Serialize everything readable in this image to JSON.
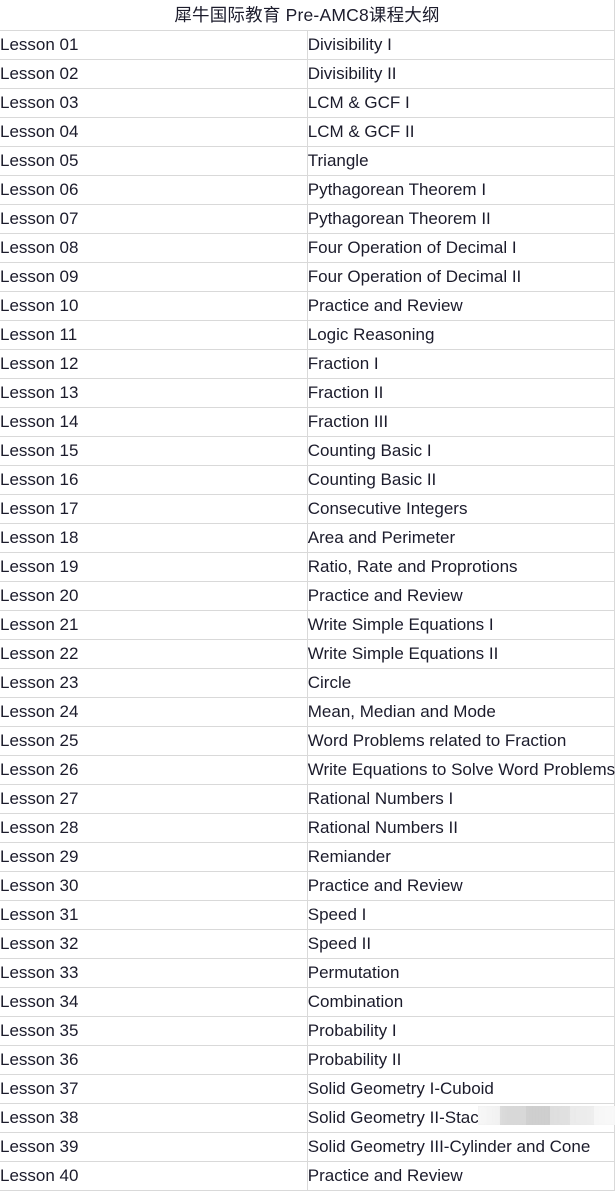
{
  "document": {
    "title": "犀牛国际教育 Pre-AMC8课程大纲"
  },
  "table": {
    "rows": [
      {
        "lesson": "Lesson 01",
        "topic": "Divisibility I"
      },
      {
        "lesson": "Lesson 02",
        "topic": "Divisibility II"
      },
      {
        "lesson": "Lesson 03",
        "topic": "LCM & GCF I"
      },
      {
        "lesson": "Lesson 04",
        "topic": "LCM & GCF II"
      },
      {
        "lesson": "Lesson 05",
        "topic": "Triangle"
      },
      {
        "lesson": "Lesson 06",
        "topic": "Pythagorean Theorem I"
      },
      {
        "lesson": "Lesson 07",
        "topic": "Pythagorean Theorem II"
      },
      {
        "lesson": "Lesson 08",
        "topic": "Four Operation of Decimal I"
      },
      {
        "lesson": "Lesson 09",
        "topic": "Four Operation of Decimal II"
      },
      {
        "lesson": "Lesson 10",
        "topic": "Practice and Review"
      },
      {
        "lesson": "Lesson 11",
        "topic": "Logic Reasoning"
      },
      {
        "lesson": "Lesson 12",
        "topic": "Fraction I"
      },
      {
        "lesson": "Lesson 13",
        "topic": "Fraction II"
      },
      {
        "lesson": "Lesson 14",
        "topic": "Fraction III"
      },
      {
        "lesson": "Lesson 15",
        "topic": "Counting Basic I"
      },
      {
        "lesson": "Lesson 16",
        "topic": "Counting Basic II"
      },
      {
        "lesson": "Lesson 17",
        "topic": "Consecutive Integers"
      },
      {
        "lesson": "Lesson 18",
        "topic": "Area and Perimeter"
      },
      {
        "lesson": "Lesson 19",
        "topic": "Ratio, Rate and Proprotions"
      },
      {
        "lesson": "Lesson 20",
        "topic": "Practice and Review"
      },
      {
        "lesson": "Lesson 21",
        "topic": "Write Simple Equations I"
      },
      {
        "lesson": "Lesson 22",
        "topic": "Write Simple Equations II"
      },
      {
        "lesson": "Lesson 23",
        "topic": "Circle"
      },
      {
        "lesson": "Lesson 24",
        "topic": "Mean, Median and Mode"
      },
      {
        "lesson": "Lesson 25",
        "topic": "Word Problems related to Fraction"
      },
      {
        "lesson": "Lesson 26",
        "topic": "Write Equations to Solve Word Problems"
      },
      {
        "lesson": "Lesson 27",
        "topic": "Rational Numbers I"
      },
      {
        "lesson": "Lesson 28",
        "topic": "Rational Numbers II"
      },
      {
        "lesson": "Lesson 29",
        "topic": "Remiander"
      },
      {
        "lesson": "Lesson 30",
        "topic": "Practice and Review"
      },
      {
        "lesson": "Lesson 31",
        "topic": "Speed I"
      },
      {
        "lesson": "Lesson 32",
        "topic": "Speed II"
      },
      {
        "lesson": "Lesson 33",
        "topic": "Permutation"
      },
      {
        "lesson": "Lesson 34",
        "topic": "Combination"
      },
      {
        "lesson": "Lesson 35",
        "topic": "Probability I"
      },
      {
        "lesson": "Lesson 36",
        "topic": "Probability II"
      },
      {
        "lesson": "Lesson 37",
        "topic": "Solid Geometry I-Cuboid"
      },
      {
        "lesson": "Lesson 38",
        "topic": "Solid Geometry II-Stack"
      },
      {
        "lesson": "Lesson 39",
        "topic": "Solid Geometry III-Cylinder and Cone"
      },
      {
        "lesson": "Lesson 40",
        "topic": "Practice and Review"
      }
    ]
  },
  "colors": {
    "text": "#1b1b2b",
    "border": "#d9d9d9",
    "background": "#ffffff",
    "redaction": "#d7d7d7"
  }
}
